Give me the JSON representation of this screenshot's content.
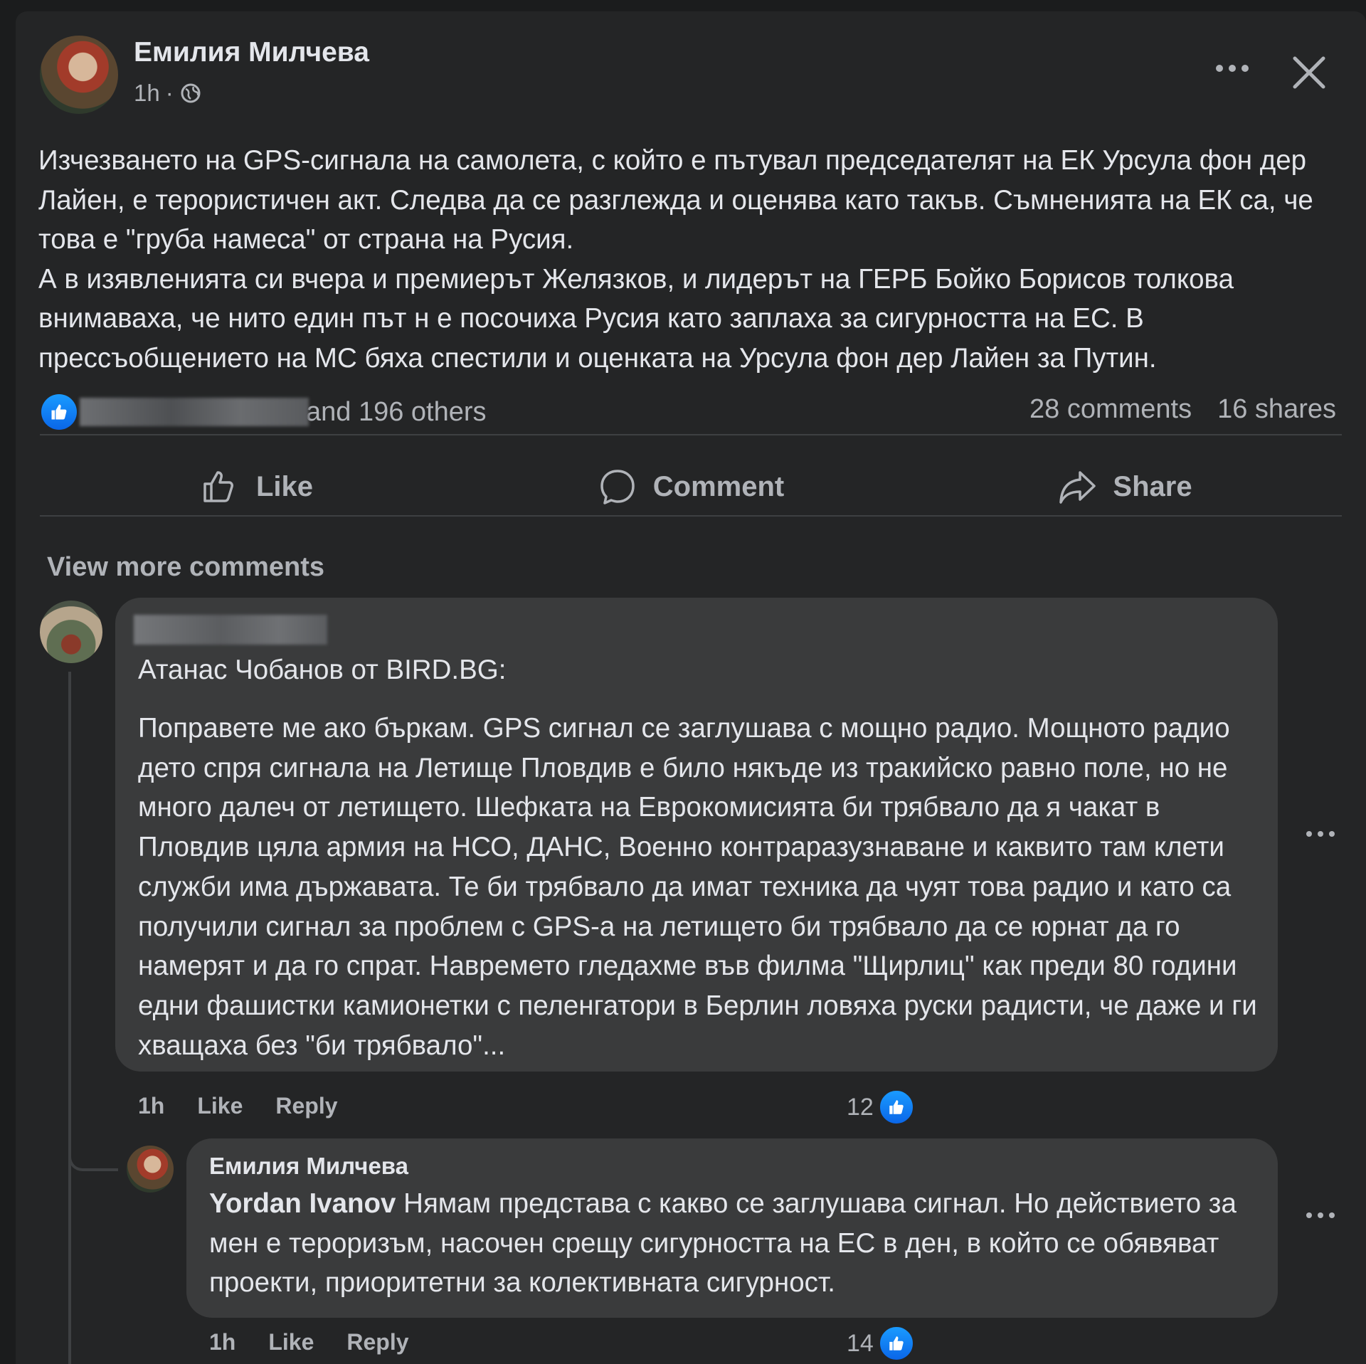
{
  "post": {
    "author": "Емилия Милчева",
    "time": "1h",
    "separator": "·",
    "paragraph1": "Изчезването на GPS-сигнала на самолета, с който е пътувал председателят на ЕК Урсула фон дер Лайен, е терористичен акт. Следва да се разглежда и оценява като такъв. Съмненията на ЕК са, че това е \"груба намеса\" от страна на Русия.",
    "paragraph2": "А в изявленията си вчера и премиерът Желязков, и лидерът на ГЕРБ Бойко Борисов толкова внимаваха, че нито един път н е посочиха Русия като заплаха за сигурността на ЕС. В прессъобщението на МС бяха спестили и оценката на Урсула фон дер Лайен за Путин.",
    "reactions_text": "and 196 others",
    "comments_count": "28 comments",
    "shares_count": "16 shares"
  },
  "actions": {
    "like": "Like",
    "comment": "Comment",
    "share": "Share"
  },
  "view_more_comments": "View more comments",
  "comments": [
    {
      "header_line": "Атанас Чобанов от BIRD.BG:",
      "body": "Поправете ме ако бъркам. GPS сигнал се заглушава с мощно радио. Мощното радио дето спря сигнала на Летище Пловдив е било някъде из тракийско равно поле, но не много далеч от летището. Шефката на Еврокомисията би трябвало да я чакат в Пловдив цяла армия на НСО, ДАНС, Военно контраразузнаване и каквито там клети служби има държавата. Те би трябвало да имат техника да чуят това радио и като са получили сигнал за проблем с GPS-а на летището би трябвало да се юрнат да го намерят и да го спрат. Навремето гледахме във филма \"Щирлиц\" как преди 80 години едни фашистки камионетки с пеленгатори в Берлин ловяха руски радисти, че даже и ги хващаха без \"би трябвало\"...",
      "time": "1h",
      "like": "Like",
      "reply": "Reply",
      "reactions": "12"
    },
    {
      "author": "Емилия Милчева",
      "mention": "Yordan Ivanov",
      "body": " Нямам представа с какво се заглушава сигнал. Но действието за мен е тероризъм, насочен срещу сигурността на ЕС в ден, в който се обявяват проекти, приоритетни за колективната сигурност.",
      "time": "1h",
      "like": "Like",
      "reply": "Reply",
      "reactions": "14"
    }
  ],
  "colors": {
    "background": "#242526",
    "bubble": "#3a3b3c",
    "text": "#e4e6eb",
    "secondary_text": "#b0b3b8",
    "like_blue": "#0a66e8"
  },
  "icons": [
    "globe-icon",
    "more-icon",
    "close-icon",
    "like-icon",
    "comment-icon",
    "share-icon",
    "like-reaction-icon"
  ]
}
